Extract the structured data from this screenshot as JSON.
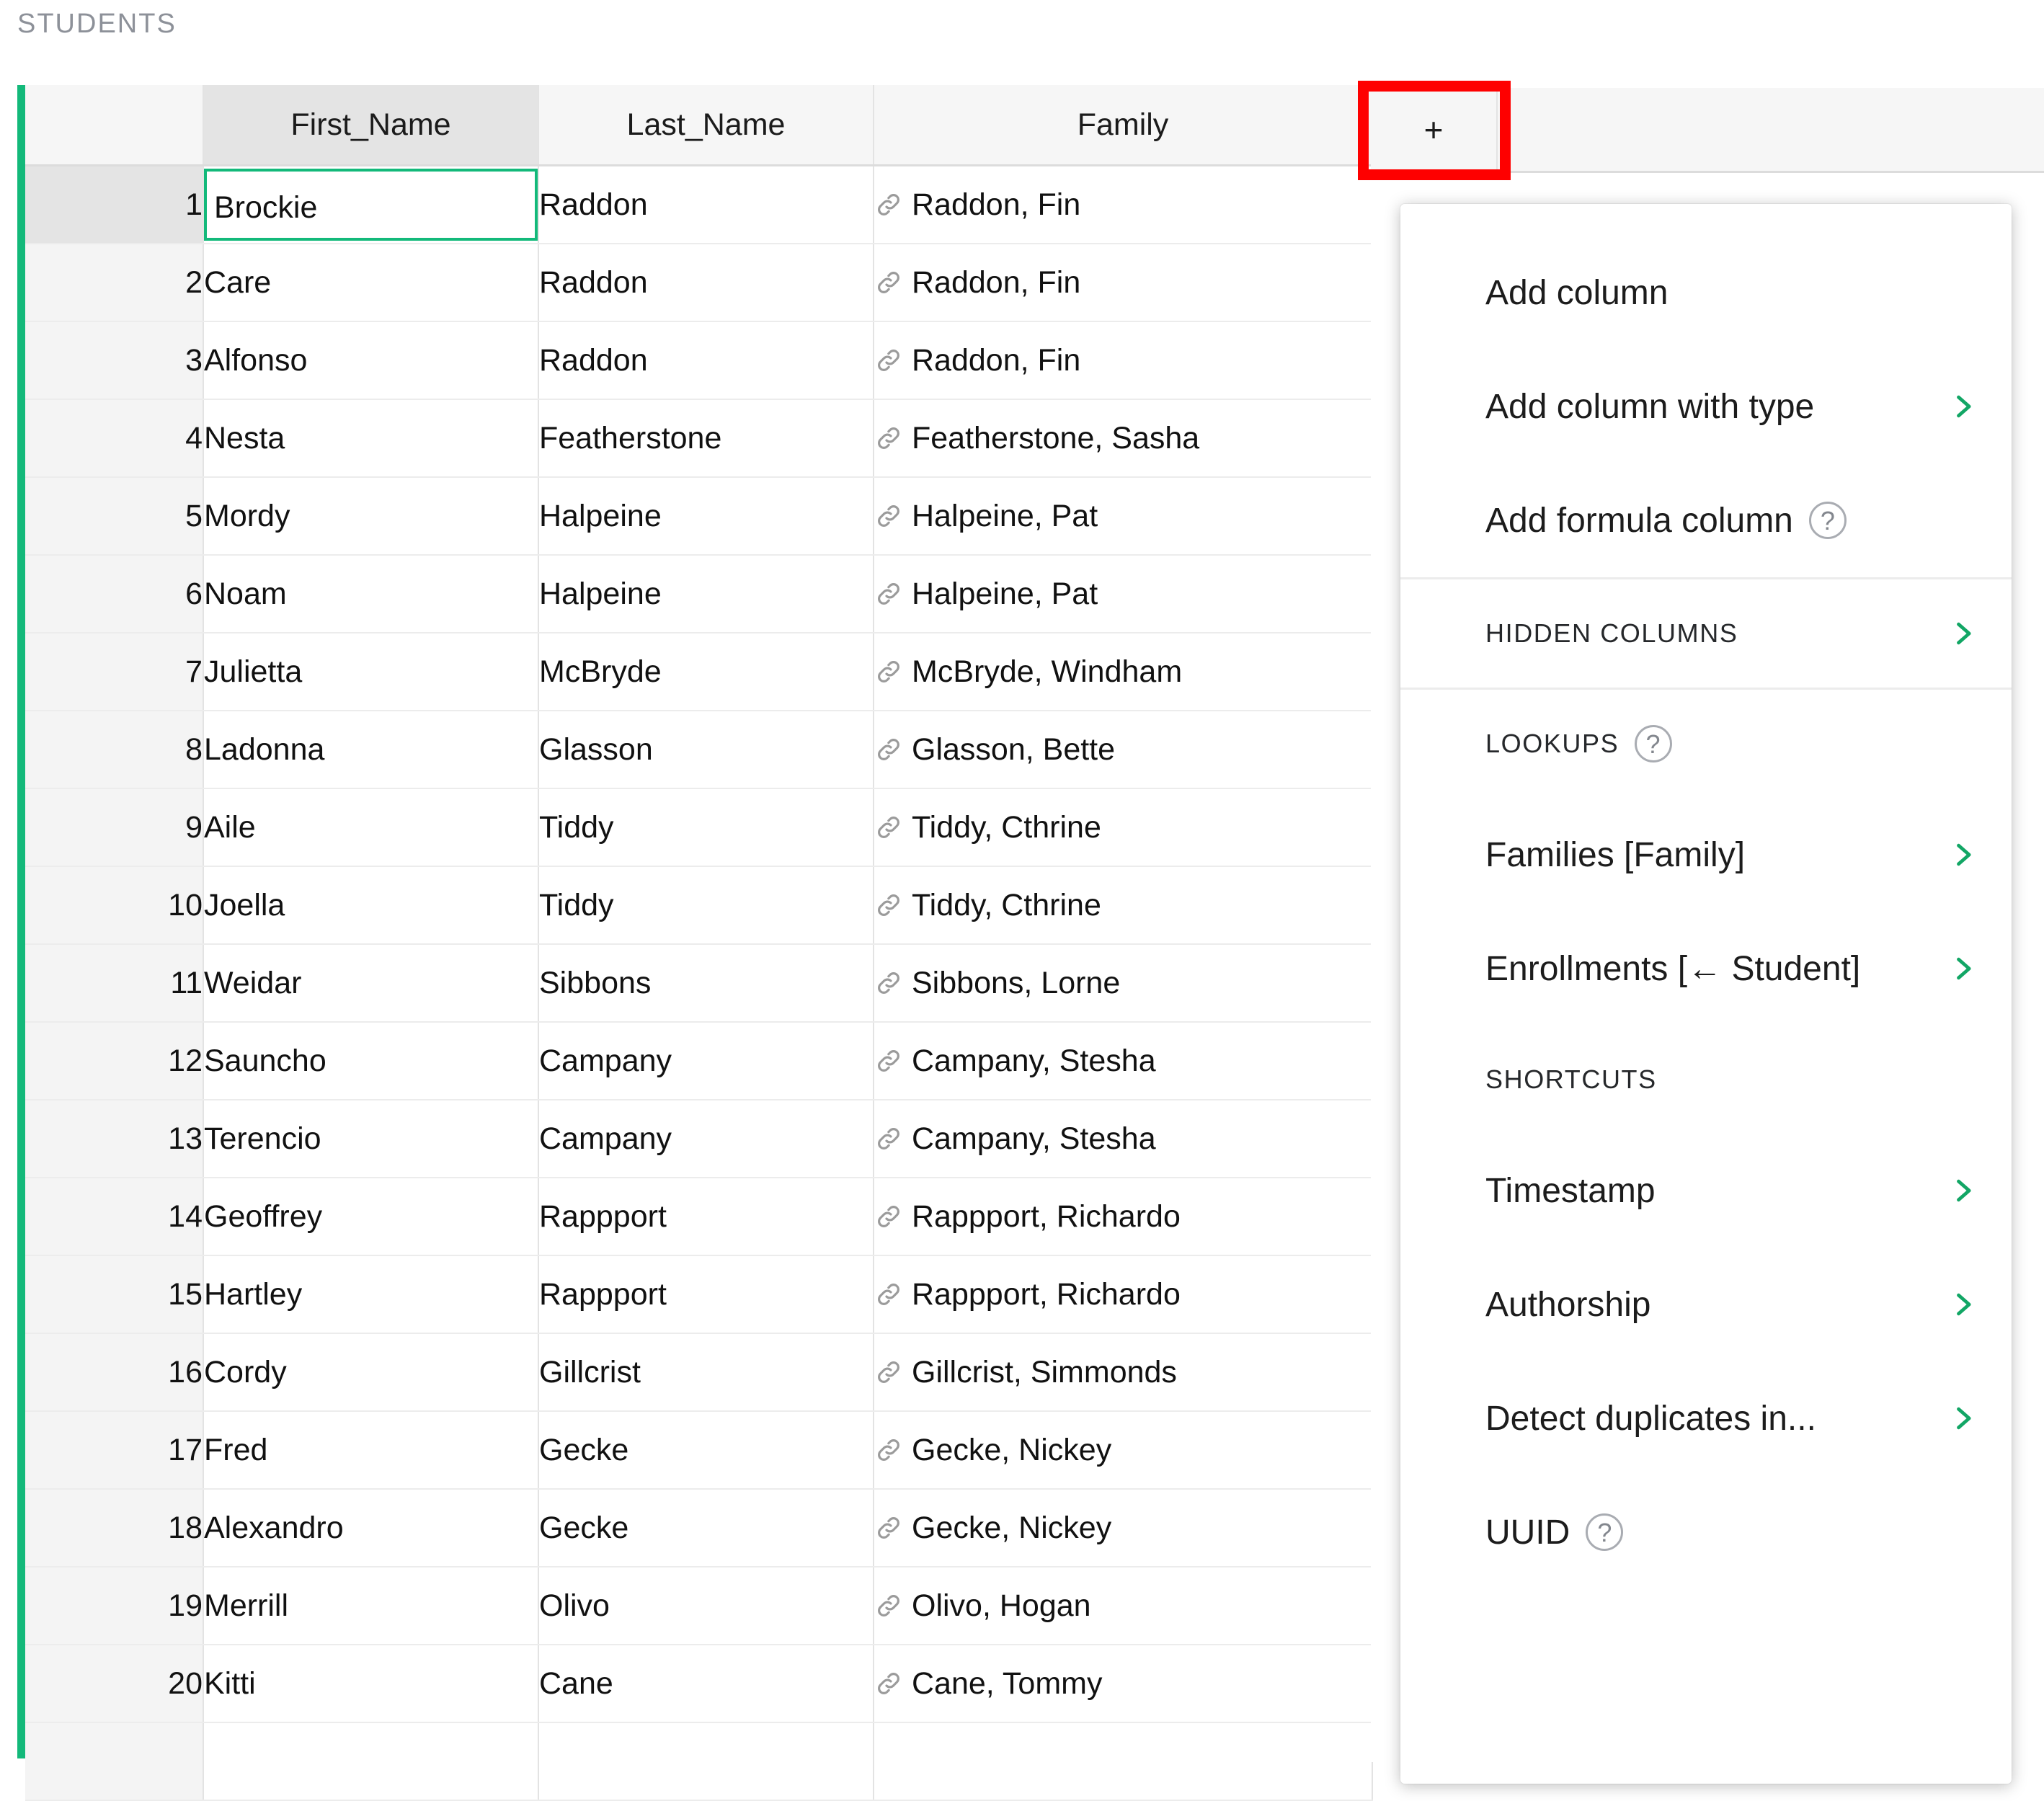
{
  "section": {
    "title": "STUDENTS"
  },
  "grid": {
    "columns": [
      {
        "key": "rownum",
        "label": ""
      },
      {
        "key": "first_name",
        "label": "First_Name"
      },
      {
        "key": "last_name",
        "label": "Last_Name"
      },
      {
        "key": "family",
        "label": "Family"
      }
    ],
    "add_column_button_label": "+",
    "selected_cell": {
      "row": 1,
      "column": "First_Name",
      "value": "Brockie"
    },
    "link_icon": "link-icon",
    "rows": [
      {
        "n": "1",
        "first": "Brockie",
        "last": "Raddon",
        "family": "Raddon, Fin"
      },
      {
        "n": "2",
        "first": "Care",
        "last": "Raddon",
        "family": "Raddon, Fin"
      },
      {
        "n": "3",
        "first": "Alfonso",
        "last": "Raddon",
        "family": "Raddon, Fin"
      },
      {
        "n": "4",
        "first": "Nesta",
        "last": "Featherstone",
        "family": "Featherstone, Sasha"
      },
      {
        "n": "5",
        "first": "Mordy",
        "last": "Halpeine",
        "family": "Halpeine, Pat"
      },
      {
        "n": "6",
        "first": "Noam",
        "last": "Halpeine",
        "family": "Halpeine, Pat"
      },
      {
        "n": "7",
        "first": "Julietta",
        "last": "McBryde",
        "family": "McBryde, Windham"
      },
      {
        "n": "8",
        "first": "Ladonna",
        "last": "Glasson",
        "family": "Glasson, Bette"
      },
      {
        "n": "9",
        "first": "Aile",
        "last": "Tiddy",
        "family": "Tiddy, Cthrine"
      },
      {
        "n": "10",
        "first": "Joella",
        "last": "Tiddy",
        "family": "Tiddy, Cthrine"
      },
      {
        "n": "11",
        "first": "Weidar",
        "last": "Sibbons",
        "family": "Sibbons, Lorne"
      },
      {
        "n": "12",
        "first": "Sauncho",
        "last": "Campany",
        "family": "Campany, Stesha"
      },
      {
        "n": "13",
        "first": "Terencio",
        "last": "Campany",
        "family": "Campany, Stesha"
      },
      {
        "n": "14",
        "first": "Geoffrey",
        "last": "Rappport",
        "family": "Rappport, Richardo"
      },
      {
        "n": "15",
        "first": "Hartley",
        "last": "Rappport",
        "family": "Rappport, Richardo"
      },
      {
        "n": "16",
        "first": "Cordy",
        "last": "Gillcrist",
        "family": "Gillcrist, Simmonds"
      },
      {
        "n": "17",
        "first": "Fred",
        "last": "Gecke",
        "family": "Gecke, Nickey"
      },
      {
        "n": "18",
        "first": "Alexandro",
        "last": "Gecke",
        "family": "Gecke, Nickey"
      },
      {
        "n": "19",
        "first": "Merrill",
        "last": "Olivo",
        "family": "Olivo, Hogan"
      },
      {
        "n": "20",
        "first": "Kitti",
        "last": "Cane",
        "family": "Cane, Tommy"
      }
    ]
  },
  "column_menu": {
    "items": {
      "add_column": "Add column",
      "add_column_with_type": "Add column with type",
      "add_formula_column": "Add formula column",
      "hidden_columns": "HIDDEN COLUMNS",
      "lookups": "LOOKUPS",
      "lookup_families": "Families [Family]",
      "lookup_enrollments": "Enrollments [← Student]",
      "shortcuts": "SHORTCUTS",
      "timestamp": "Timestamp",
      "authorship": "Authorship",
      "detect_duplicates": "Detect duplicates in...",
      "uuid": "UUID"
    },
    "help_glyph": "?"
  },
  "colors": {
    "accent_green": "#13b97a",
    "chevron_green": "#12a665",
    "highlight_red": "#fe0000",
    "header_bg": "#f6f6f6",
    "selected_header_bg": "#e4e4e4"
  }
}
